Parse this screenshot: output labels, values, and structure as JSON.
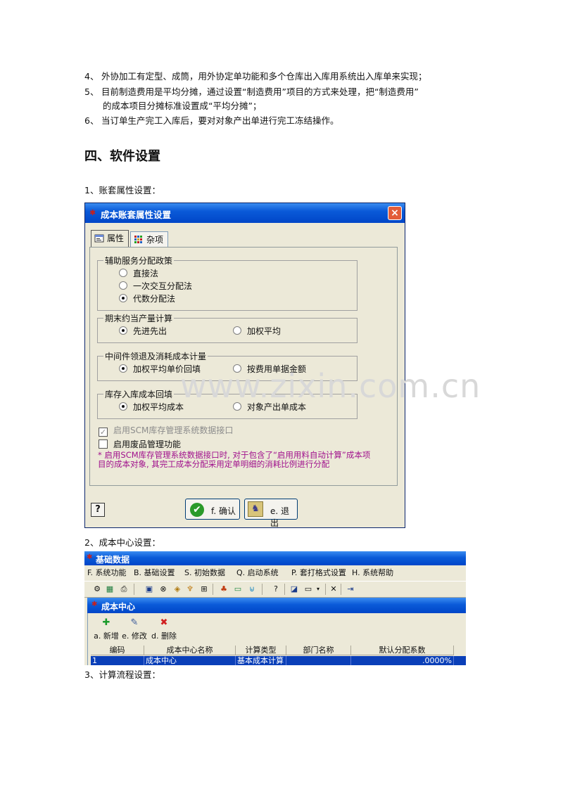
{
  "doc": {
    "items": [
      {
        "num": "4、",
        "text": "外协加工有定型、成筒，用外协定单功能和多个仓库出入库用系统出入库单来实现；"
      },
      {
        "num": "5、",
        "text": "目前制造费用是平均分摊，通过设置“制造费用”项目的方式来处理，把“制造费用”"
      },
      {
        "num": "",
        "text": "的成本项目分摊标准设置成“平均分摊”；"
      },
      {
        "num": "6、",
        "text": "当订单生产完工入库后，要对对象产出单进行完工冻结操作。"
      }
    ],
    "section_title": "四、软件设置",
    "step1": "1、账套属性设置：",
    "step2": "2、成本中心设置：",
    "step3": "3、计算流程设置：",
    "watermark": "www.zixin.com.cn"
  },
  "dialog": {
    "title": "成本账套属性设置",
    "close": "×",
    "tabs": [
      "属性",
      "杂项"
    ],
    "groups": [
      {
        "title": "辅助服务分配政策",
        "options": [
          "直接法",
          "一次交互分配法",
          "代数分配法"
        ],
        "selected": 2
      },
      {
        "title": "期末约当产量计算",
        "options": [
          "先进先出",
          "加权平均"
        ],
        "selected": 0
      },
      {
        "title": "中间件领退及消耗成本计量",
        "options": [
          "加权平均单价回填",
          "按费用单据金额"
        ],
        "selected": 0
      },
      {
        "title": "库存入库成本回填",
        "options": [
          "加权平均成本",
          "对象产出单成本"
        ],
        "selected": 0
      }
    ],
    "checks": [
      {
        "label": "启用SCM库存管理系统数据接口",
        "checked": true,
        "disabled": true
      },
      {
        "label": "启用废品管理功能",
        "checked": false,
        "disabled": false
      }
    ],
    "note": "* 启用SCM库存管理系统数据接口时, 对于包含了“启用用料自动计算”成本项目的成本对象, 其完工成本分配采用定单明细的消耗比例进行分配",
    "ok_label": "f. 确认",
    "exit_label": "e. 退出",
    "help_label": "?",
    "colors": {
      "title_blue": "#0a5ad8",
      "note": "#a0108c",
      "face": "#ece9d8"
    }
  },
  "window2": {
    "title": "基础数据",
    "menu": [
      "F. 系统功能",
      "B. 基础设置",
      "S. 初始数据",
      "Q. 启动系统",
      "P. 套打格式设置",
      "H. 系统帮助"
    ],
    "inner_title": "成本中心",
    "actions": [
      "a. 新增",
      "e. 修改",
      "d. 删除"
    ],
    "columns": [
      "编码",
      "成本中心名称",
      "计算类型",
      "部门名称",
      "默认分配系数"
    ],
    "rows": [
      [
        "1",
        "成本中心",
        "基本成本计算",
        "",
        ".0000%"
      ]
    ]
  }
}
